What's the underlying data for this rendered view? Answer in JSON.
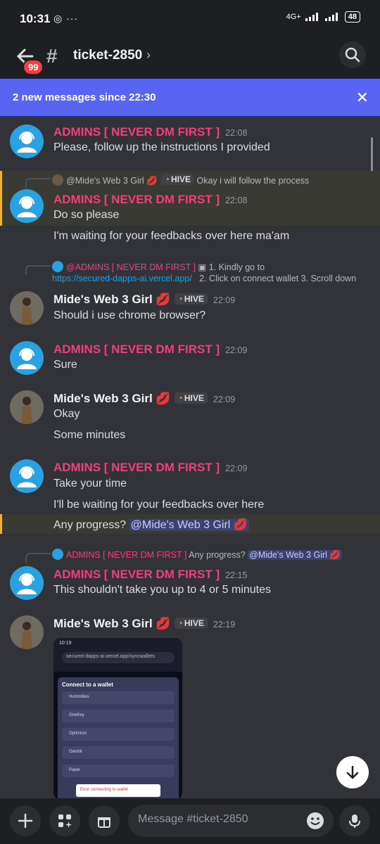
{
  "status_bar": {
    "time": "10:31",
    "network": "4G+",
    "battery": "48"
  },
  "header": {
    "badge": "99",
    "channel": "ticket-2850"
  },
  "banner": {
    "text": "2 new messages since 22:30"
  },
  "names": {
    "admin": "ADMINS [ NEVER DM FIRST ]",
    "mide": "Mide's Web 3 Girl 💋",
    "hive": "HIVE"
  },
  "messages": {
    "m1": {
      "time": "22:08",
      "text": "Please, follow up the instructions I provided"
    },
    "m2": {
      "reply_author": "@Mide's Web 3 Girl 💋",
      "reply_tag": "HIVE",
      "reply_text": "Okay i will follow the process",
      "time": "22:08",
      "text": "Do so please",
      "text2": "I'm waiting for your feedbacks over here ma'am"
    },
    "m3": {
      "reply_author": "@ADMINS [ NEVER DM FIRST ]",
      "reply_text1": "1.  Kindly go to",
      "reply_link": "https://secured-dapps-ai.vercel.app/",
      "reply_text2": "2.  Click on connect wallet    3.  Scroll down",
      "time": "22:09",
      "text": "Should i use chrome browser?"
    },
    "m4": {
      "time": "22:09",
      "text": "Sure"
    },
    "m5": {
      "time": "22:09",
      "text": "Okay",
      "text2": "Some minutes"
    },
    "m6": {
      "time": "22:09",
      "text": "Take your time",
      "text2": "I'll be waiting for your feedbacks over here",
      "text3": "Any progress?",
      "mention": "@Mide's Web 3 Girl 💋"
    },
    "m7": {
      "reply_author": "ADMINS [ NEVER DM FIRST ]",
      "reply_text": "Any progress?",
      "reply_mention": "@Mide's Web 3 Girl 💋",
      "time": "22:15",
      "text": "This shouldn't take you up to 4 or 5 minutes"
    },
    "m8": {
      "time": "22:19"
    }
  },
  "attachment": {
    "status_time": "10:19",
    "url": "secured-dapps-ai.vercel.app/syncwallets",
    "title": "Connect to a wallet",
    "items": [
      "Hummbles",
      "OneKey",
      "Optimism",
      "Ownbit",
      "Paper"
    ],
    "error": "Error connecting to wallet"
  },
  "composer": {
    "placeholder": "Message #ticket-2850"
  },
  "icons": {
    "back": "arrow-left-icon",
    "hash": "hash-lock-icon",
    "search": "search-icon",
    "close": "close-icon",
    "plus": "plus-icon",
    "apps": "apps-icon",
    "gift": "gift-icon",
    "emoji": "emoji-icon",
    "mic": "microphone-icon",
    "down": "arrow-down-icon"
  },
  "colors": {
    "blurple": "#5865f2",
    "admin_name": "#f23f79",
    "highlight_bar": "#f0b232",
    "link": "#00a8fc"
  }
}
